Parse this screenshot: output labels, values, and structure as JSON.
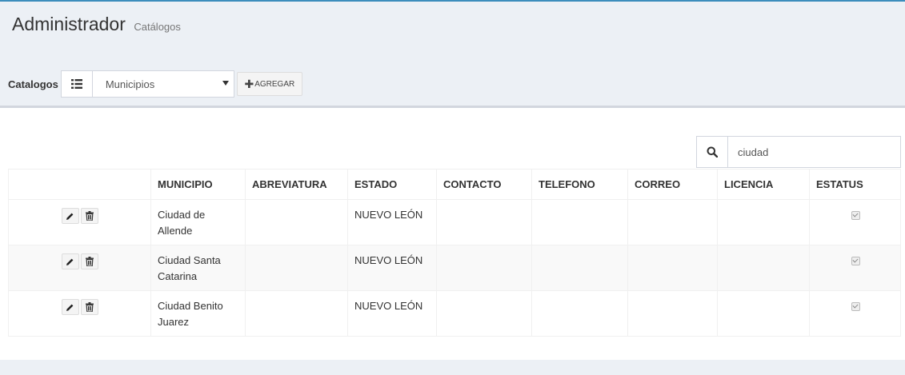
{
  "header": {
    "title": "Administrador",
    "subtitle": "Catálogos"
  },
  "toolbar": {
    "label": "Catalogos",
    "select_value": "Municipios",
    "add_label": "AGREGAR",
    "add_icon": "plus-icon",
    "select_icon": "list-icon"
  },
  "search": {
    "value": "ciudad",
    "icon": "search-icon"
  },
  "table": {
    "columns": [
      "",
      "MUNICIPIO",
      "ABREVIATURA",
      "ESTADO",
      "CONTACTO",
      "TELEFONO",
      "CORREO",
      "LICENCIA",
      "ESTATUS"
    ],
    "rows": [
      {
        "municipio": "Ciudad de Allende",
        "abreviatura": "",
        "estado": "NUEVO LEÓN",
        "contacto": "",
        "telefono": "",
        "correo": "",
        "licencia": "",
        "estatus": true
      },
      {
        "municipio": "Ciudad Santa Catarina",
        "abreviatura": "",
        "estado": "NUEVO LEÓN",
        "contacto": "",
        "telefono": "",
        "correo": "",
        "licencia": "",
        "estatus": true
      },
      {
        "municipio": "Ciudad Benito Juarez",
        "abreviatura": "",
        "estado": "NUEVO LEÓN",
        "contacto": "",
        "telefono": "",
        "correo": "",
        "licencia": "",
        "estatus": true
      }
    ],
    "row_actions": [
      "edit-icon",
      "trash-icon"
    ]
  },
  "colors": {
    "accent": "#3c8dbc",
    "background": "#ecf0f5"
  }
}
